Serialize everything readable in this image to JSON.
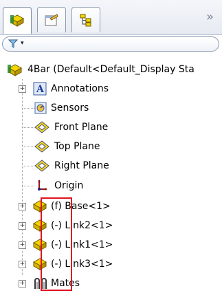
{
  "tabs": [
    {
      "name": "featuremanager-tab",
      "icon": "feature-manager-icon",
      "active": true
    },
    {
      "name": "propertymanager-tab",
      "icon": "property-manager-icon",
      "active": false
    },
    {
      "name": "configurationmanager-tab",
      "icon": "configuration-manager-icon",
      "active": false
    }
  ],
  "overflow_glyph": "»",
  "filter": {
    "icon": "filter-icon",
    "caret": "▾"
  },
  "tree": {
    "root_label": "4Bar  (Default<Default_Display Sta",
    "items": [
      {
        "label": "Annotations",
        "icon": "annotations-icon",
        "expandable": true
      },
      {
        "label": "Sensors",
        "icon": "sensors-icon",
        "expandable": false
      },
      {
        "label": "Front Plane",
        "icon": "plane-icon",
        "expandable": false
      },
      {
        "label": "Top Plane",
        "icon": "plane-icon",
        "expandable": false
      },
      {
        "label": "Right Plane",
        "icon": "plane-icon",
        "expandable": false
      },
      {
        "label": "Origin",
        "icon": "origin-icon",
        "expandable": false
      },
      {
        "label": "(f) Base<1>",
        "icon": "part-icon",
        "expandable": true
      },
      {
        "label": "(-) Link2<1>",
        "icon": "part-icon",
        "expandable": true
      },
      {
        "label": "(-) Link1<1>",
        "icon": "part-icon",
        "expandable": true
      },
      {
        "label": "(-) Link3<1>",
        "icon": "part-icon",
        "expandable": true
      },
      {
        "label": "Mates",
        "icon": "mates-icon",
        "expandable": true
      }
    ]
  },
  "colors": {
    "highlight_box": "#e0121e",
    "plane": "#e8d200",
    "part": "#e3c200"
  }
}
